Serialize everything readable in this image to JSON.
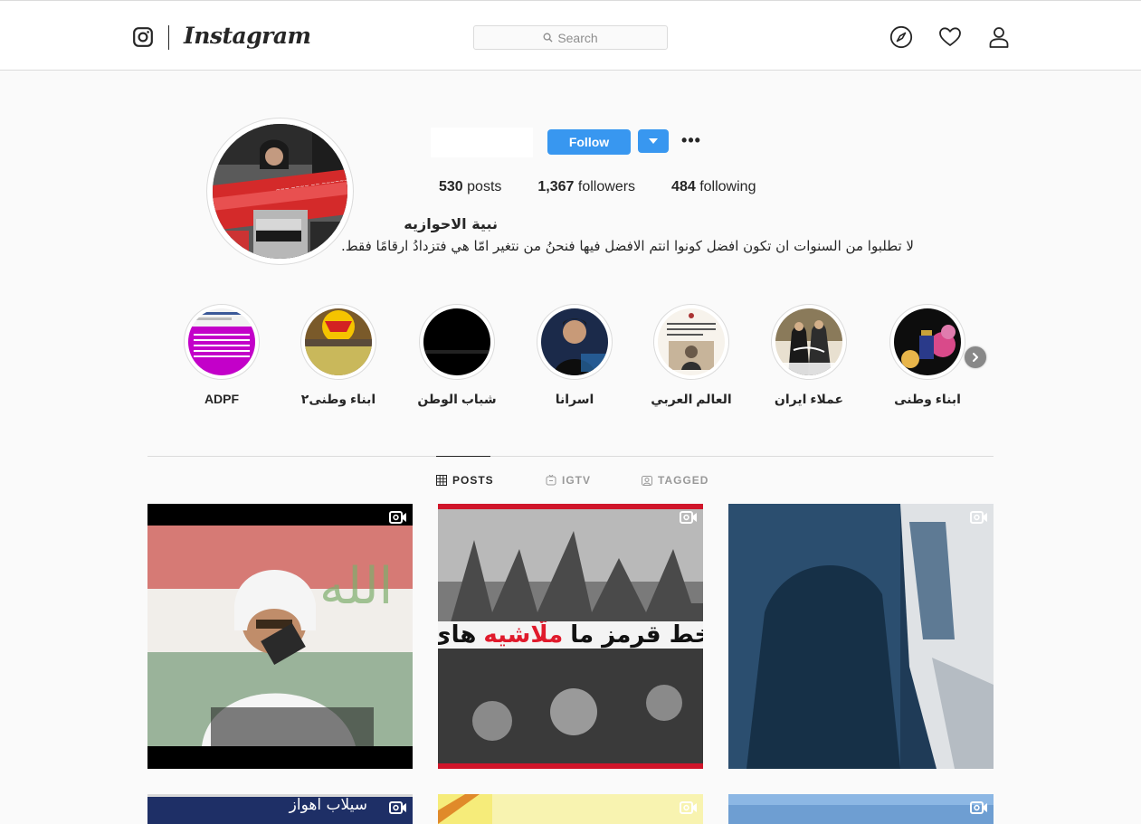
{
  "app": {
    "brand": "Instagram"
  },
  "search": {
    "placeholder": "Search"
  },
  "nav": {
    "icons": [
      "compass-icon",
      "heart-icon",
      "user-icon"
    ]
  },
  "profile": {
    "follow_label": "Follow",
    "more_label": "•••",
    "stats": {
      "posts": "530",
      "posts_label": "posts",
      "followers": "1,367",
      "followers_label": "followers",
      "following": "484",
      "following_label": "following"
    },
    "full_name": "نبية الاحوازيه",
    "bio": "لا تطلبوا من السنوات ان تكون افضل كونوا انتم الافضل فيها فنحنُ من نتغير امّا هي فتزدادُ ارقامًا فقط."
  },
  "highlights": [
    {
      "label": "ADPF"
    },
    {
      "label": "ابناء وطنی۲"
    },
    {
      "label": "شباب الوطن"
    },
    {
      "label": "اسرانا"
    },
    {
      "label": "العالم العربي"
    },
    {
      "label": "عملاء ایران"
    },
    {
      "label": "ابناء وطنی"
    }
  ],
  "tabs": [
    {
      "label": "POSTS",
      "active": true
    },
    {
      "label": "IGTV",
      "active": false
    },
    {
      "label": "TAGGED",
      "active": false
    }
  ],
  "posts": {
    "p2_overlay_dark": "خط قرمز ما",
    "p2_overlay_red": "ملّاشيه",
    "p2_overlay_prefix": "های",
    "p4_title": "سيلاب اهواز"
  },
  "colors": {
    "accent": "#3897f0",
    "text": "#262626",
    "border": "#dbdbdb",
    "muted": "#8e8e8e"
  }
}
